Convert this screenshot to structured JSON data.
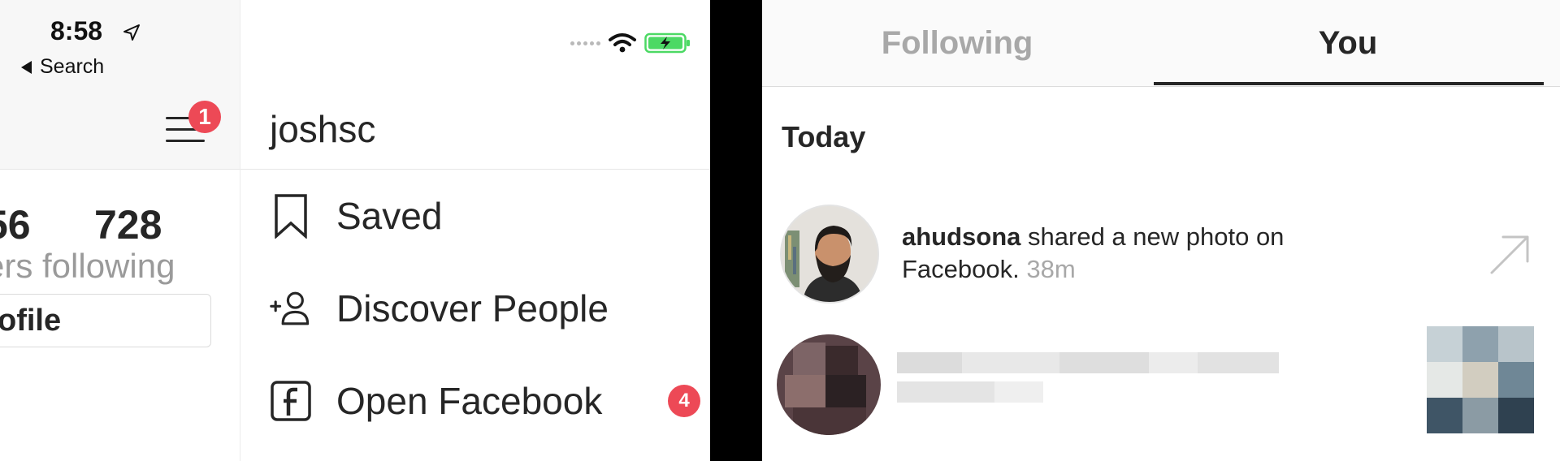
{
  "left_screen": {
    "status_bar": {
      "time": "8:58",
      "back_label": "Search"
    },
    "menu_notification_count": "1",
    "profile_stats": {
      "followers_count_partial": "56",
      "following_count": "728",
      "labels_partial": "ers following"
    },
    "edit_profile_partial": "ofile",
    "drawer": {
      "username": "joshsc",
      "items": [
        {
          "label": "Saved",
          "icon": "bookmark-icon"
        },
        {
          "label": "Discover People",
          "icon": "add-person-icon"
        },
        {
          "label": "Open Facebook",
          "icon": "facebook-icon",
          "badge": "4"
        }
      ]
    }
  },
  "right_screen": {
    "tabs": [
      {
        "label": "Following",
        "active": false
      },
      {
        "label": "You",
        "active": true
      }
    ],
    "section_heading": "Today",
    "notifications": [
      {
        "username": "ahudsona",
        "message": " shared a new photo on Facebook.",
        "time": "38m",
        "action_icon": "share-arrow-icon"
      }
    ]
  },
  "colors": {
    "badge_red": "#ed4956",
    "battery_green": "#4cd964",
    "text_primary": "#262626",
    "text_secondary": "#a8a8a8"
  }
}
